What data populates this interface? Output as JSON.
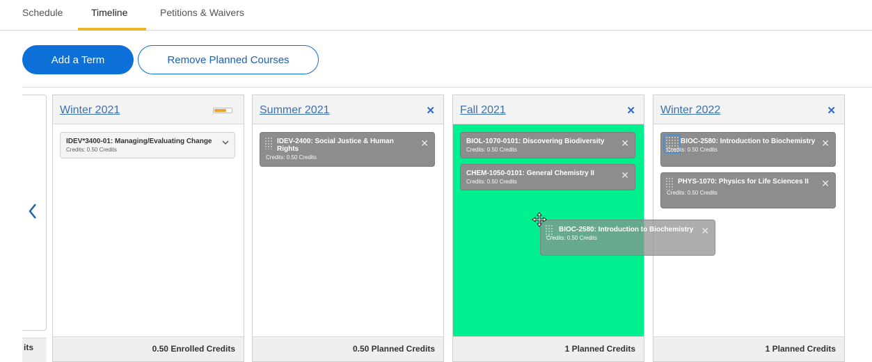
{
  "tabs": [
    {
      "label": "Schedule"
    },
    {
      "label": "Timeline"
    },
    {
      "label": "Petitions & Waivers"
    }
  ],
  "actions": {
    "add_term": "Add a Term",
    "remove_planned": "Remove Planned Courses"
  },
  "left_column": {
    "footer_text": "its",
    "arrow_icon": "chevron-left-icon"
  },
  "terms": [
    {
      "title": "Winter 2021",
      "credits": "0.50 Enrolled Credits",
      "progress": 0.7,
      "courses": [
        {
          "title": "IDEV*3400-01: Managing/Evaluating Change",
          "credits": "Credits: 0.50 Credits",
          "status": "enrolled"
        }
      ]
    },
    {
      "title": "Summer 2021",
      "credits": "0.50 Planned Credits",
      "courses": [
        {
          "title": "IDEV-2400: Social Justice & Human Rights",
          "credits": "Credits: 0.50 Credits",
          "status": "planned"
        }
      ]
    },
    {
      "title": "Fall 2021",
      "credits": "1 Planned Credits",
      "drop_highlight": "#00f090",
      "courses": [
        {
          "title": "BIOL-1070-0101: Discovering Biodiversity",
          "credits": "Credits: 0.50 Credits",
          "status": "planned"
        },
        {
          "title": "CHEM-1050-0101: General Chemistry II",
          "credits": "Credits: 0.50 Credits",
          "status": "planned"
        }
      ]
    },
    {
      "title": "Winter 2022",
      "credits": "1 Planned Credits",
      "courses": [
        {
          "title": "BIOC-2580: Introduction to Biochemistry",
          "credits": "Credits: 0.50 Credits",
          "status": "planned"
        },
        {
          "title": "PHYS-1070: Physics for Life Sciences II",
          "credits": "Credits: 0.50 Credits",
          "status": "planned"
        }
      ]
    }
  ],
  "dragging": {
    "title": "BIOC-2580: Introduction to Biochemistry",
    "credits": "Credits: 0.50 Credits"
  },
  "icons": {
    "close": "close-icon",
    "remove": "×",
    "move_cursor": "move-cursor-icon"
  },
  "colors": {
    "primary": "#0d6fd8",
    "tab_underline": "#f0b323",
    "planned_card": "#8d8d8d",
    "drop_target": "#00f090"
  }
}
